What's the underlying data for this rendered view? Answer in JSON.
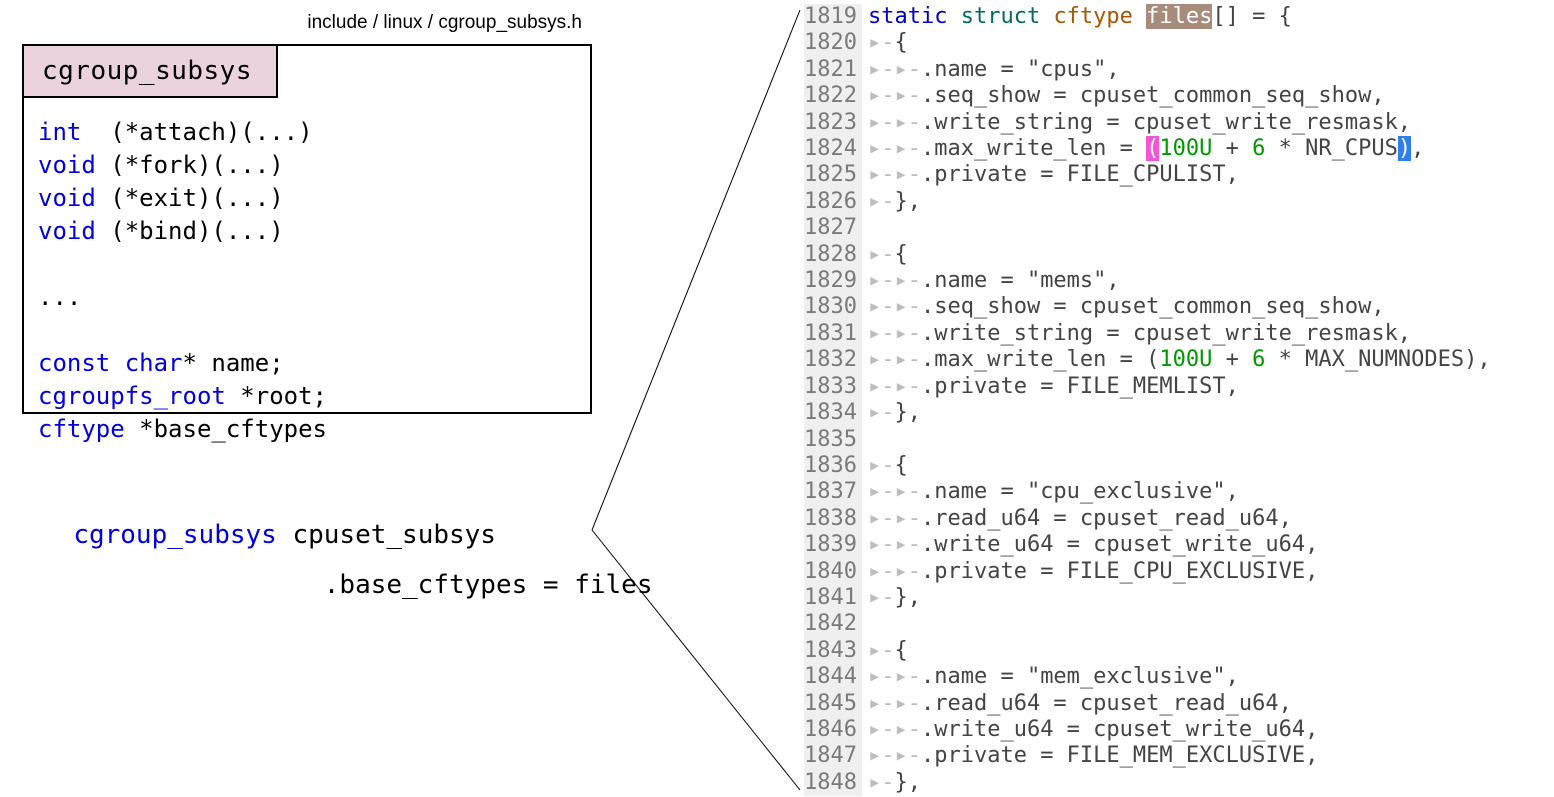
{
  "struct": {
    "title": "cgroup_subsys",
    "path": "include / linux / cgroup_subsys.h",
    "lines": [
      [
        {
          "t": "int  ",
          "c": "kw"
        },
        {
          "t": "(*attach)(...)",
          "c": ""
        }
      ],
      [
        {
          "t": "void ",
          "c": "kw"
        },
        {
          "t": "(*fork)(...)",
          "c": ""
        }
      ],
      [
        {
          "t": "void ",
          "c": "kw"
        },
        {
          "t": "(*exit)(...)",
          "c": ""
        }
      ],
      [
        {
          "t": "void ",
          "c": "kw"
        },
        {
          "t": "(*bind)(...)",
          "c": ""
        }
      ],
      [
        {
          "t": "",
          "c": ""
        }
      ],
      [
        {
          "t": "...",
          "c": ""
        }
      ],
      [
        {
          "t": "",
          "c": ""
        }
      ],
      [
        {
          "t": "const char",
          "c": "kw"
        },
        {
          "t": "* name;",
          "c": ""
        }
      ],
      [
        {
          "t": "cgroupfs_root ",
          "c": "kw"
        },
        {
          "t": "*root;",
          "c": ""
        }
      ],
      [
        {
          "t": "cftype ",
          "c": "kw"
        },
        {
          "t": "*base_cftypes",
          "c": ""
        }
      ]
    ]
  },
  "lower": {
    "line1_pre": "cgroup_subsys",
    "line1_post": " cpuset_subsys",
    "line2": "                  .base_cftypes = files"
  },
  "editor": {
    "ws1": "▸-",
    "ws2": "▸-▸-",
    "lines": [
      {
        "n": 1819,
        "segs": [
          {
            "t": "static ",
            "c": "kwblue"
          },
          {
            "t": "struct ",
            "c": "kwteal"
          },
          {
            "t": "cftype ",
            "c": "kworange"
          },
          {
            "t": "files",
            "c": "hlword"
          },
          {
            "t": "[] = {",
            "c": ""
          }
        ]
      },
      {
        "n": 1820,
        "ws": 1,
        "segs": [
          {
            "t": "{",
            "c": ""
          }
        ]
      },
      {
        "n": 1821,
        "ws": 2,
        "segs": [
          {
            "t": ".name = \"cpus\",",
            "c": ""
          }
        ]
      },
      {
        "n": 1822,
        "ws": 2,
        "segs": [
          {
            "t": ".seq_show = cpuset_common_seq_show,",
            "c": ""
          }
        ]
      },
      {
        "n": 1823,
        "ws": 2,
        "segs": [
          {
            "t": ".write_string = cpuset_write_resmask,",
            "c": ""
          }
        ]
      },
      {
        "n": 1824,
        "ws": 2,
        "segs": [
          {
            "t": ".max_write_len = ",
            "c": ""
          },
          {
            "t": "(",
            "c": "hlparen1"
          },
          {
            "t": "100U",
            "c": "kwgreen"
          },
          {
            "t": " + ",
            "c": ""
          },
          {
            "t": "6",
            "c": "kwgreen"
          },
          {
            "t": " * NR_CPUS",
            "c": ""
          },
          {
            "t": ")",
            "c": "hlparen2"
          },
          {
            "t": ",",
            "c": ""
          }
        ]
      },
      {
        "n": 1825,
        "ws": 2,
        "segs": [
          {
            "t": ".private = FILE_CPULIST,",
            "c": ""
          }
        ]
      },
      {
        "n": 1826,
        "ws": 1,
        "segs": [
          {
            "t": "},",
            "c": ""
          }
        ]
      },
      {
        "n": 1827,
        "segs": []
      },
      {
        "n": 1828,
        "ws": 1,
        "segs": [
          {
            "t": "{",
            "c": ""
          }
        ]
      },
      {
        "n": 1829,
        "ws": 2,
        "segs": [
          {
            "t": ".name = \"mems\",",
            "c": ""
          }
        ]
      },
      {
        "n": 1830,
        "ws": 2,
        "segs": [
          {
            "t": ".seq_show = cpuset_common_seq_show,",
            "c": ""
          }
        ]
      },
      {
        "n": 1831,
        "ws": 2,
        "segs": [
          {
            "t": ".write_string = cpuset_write_resmask,",
            "c": ""
          }
        ]
      },
      {
        "n": 1832,
        "ws": 2,
        "segs": [
          {
            "t": ".max_write_len = (",
            "c": ""
          },
          {
            "t": "100U",
            "c": "kwgreen"
          },
          {
            "t": " + ",
            "c": ""
          },
          {
            "t": "6",
            "c": "kwgreen"
          },
          {
            "t": " * MAX_NUMNODES),",
            "c": ""
          }
        ]
      },
      {
        "n": 1833,
        "ws": 2,
        "segs": [
          {
            "t": ".private = FILE_MEMLIST,",
            "c": ""
          }
        ]
      },
      {
        "n": 1834,
        "ws": 1,
        "segs": [
          {
            "t": "},",
            "c": ""
          }
        ]
      },
      {
        "n": 1835,
        "segs": []
      },
      {
        "n": 1836,
        "ws": 1,
        "segs": [
          {
            "t": "{",
            "c": ""
          }
        ]
      },
      {
        "n": 1837,
        "ws": 2,
        "segs": [
          {
            "t": ".name = \"cpu_exclusive\",",
            "c": ""
          }
        ]
      },
      {
        "n": 1838,
        "ws": 2,
        "segs": [
          {
            "t": ".read_u64 = cpuset_read_u64,",
            "c": ""
          }
        ]
      },
      {
        "n": 1839,
        "ws": 2,
        "segs": [
          {
            "t": ".write_u64 = cpuset_write_u64,",
            "c": ""
          }
        ]
      },
      {
        "n": 1840,
        "ws": 2,
        "segs": [
          {
            "t": ".private = FILE_CPU_EXCLUSIVE,",
            "c": ""
          }
        ]
      },
      {
        "n": 1841,
        "ws": 1,
        "segs": [
          {
            "t": "},",
            "c": ""
          }
        ]
      },
      {
        "n": 1842,
        "segs": []
      },
      {
        "n": 1843,
        "ws": 1,
        "segs": [
          {
            "t": "{",
            "c": ""
          }
        ]
      },
      {
        "n": 1844,
        "ws": 2,
        "segs": [
          {
            "t": ".name = \"mem_exclusive\",",
            "c": ""
          }
        ]
      },
      {
        "n": 1845,
        "ws": 2,
        "segs": [
          {
            "t": ".read_u64 = cpuset_read_u64,",
            "c": ""
          }
        ]
      },
      {
        "n": 1846,
        "ws": 2,
        "segs": [
          {
            "t": ".write_u64 = cpuset_write_u64,",
            "c": ""
          }
        ]
      },
      {
        "n": 1847,
        "ws": 2,
        "segs": [
          {
            "t": ".private = FILE_MEM_EXCLUSIVE,",
            "c": ""
          }
        ]
      },
      {
        "n": 1848,
        "ws": 1,
        "segs": [
          {
            "t": "},",
            "c": ""
          }
        ]
      }
    ]
  }
}
